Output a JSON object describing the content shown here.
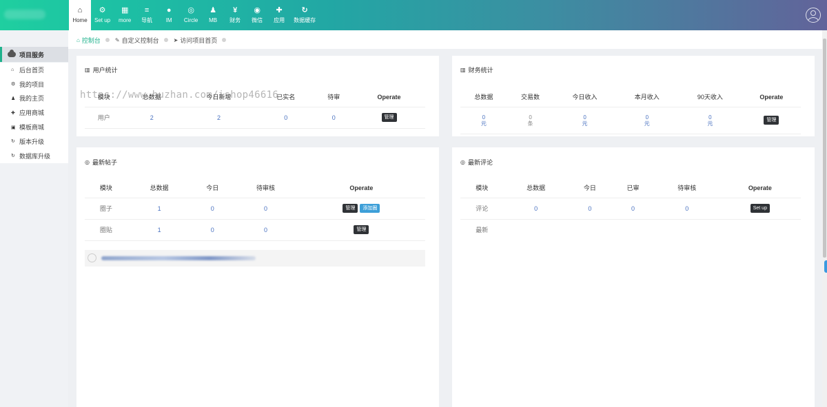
{
  "nav": [
    {
      "icon": "⌂",
      "label": "Home",
      "active": true
    },
    {
      "icon": "⚙",
      "label": "Set up"
    },
    {
      "icon": "▦",
      "label": "more"
    },
    {
      "icon": "≡",
      "label": "导航"
    },
    {
      "icon": "●",
      "label": "IM"
    },
    {
      "icon": "◎",
      "label": "Circle"
    },
    {
      "icon": "♟",
      "label": "MB"
    },
    {
      "icon": "¥",
      "label": "财务"
    },
    {
      "icon": "◉",
      "label": "微信"
    },
    {
      "icon": "✚",
      "label": "应用"
    },
    {
      "icon": "↻",
      "label": "数据缓存"
    }
  ],
  "sidebar": {
    "heading": "项目服务",
    "items": [
      {
        "icon": "⌂",
        "label": "后台首页"
      },
      {
        "icon": "⚙",
        "label": "我的项目"
      },
      {
        "icon": "♟",
        "label": "我的主页"
      },
      {
        "icon": "✚",
        "label": "应用商城"
      },
      {
        "icon": "▣",
        "label": "模板商城"
      },
      {
        "icon": "↻",
        "label": "版本升级"
      },
      {
        "icon": "↻",
        "label": "数据库升级"
      }
    ]
  },
  "breadcrumb": [
    {
      "icon": "⌂",
      "label": "控制台",
      "active": true
    },
    {
      "icon": "✎",
      "label": "自定义控制台"
    },
    {
      "icon": "➤",
      "label": "访问项目首页"
    }
  ],
  "watermark": "https://www.huzhan.com/ishop46616",
  "user_stats": {
    "title": "用户统计",
    "headers": [
      "模块",
      "总数据",
      "今日新增",
      "已实名",
      "待审",
      "Operate"
    ],
    "row": {
      "label": "用户",
      "total": "2",
      "today": "2",
      "verified": "0",
      "pending": "0",
      "button": "管理"
    }
  },
  "finance_stats": {
    "title": "财务统计",
    "headers": [
      "总数据",
      "交易数",
      "今日收入",
      "本月收入",
      "90天收入",
      "Operate"
    ],
    "row": {
      "total": "0",
      "total_unit": "元",
      "trades": "0",
      "trades_unit": "条",
      "today": "0",
      "today_unit": "元",
      "month": "0",
      "month_unit": "元",
      "days90": "0",
      "days90_unit": "元",
      "button": "管理"
    }
  },
  "latest_posts": {
    "title": "最新帖子",
    "headers": [
      "模块",
      "总数据",
      "今日",
      "待审核",
      "Operate"
    ],
    "rows": [
      {
        "label": "圈子",
        "total": "1",
        "today": "0",
        "pending": "0",
        "button": "管理",
        "button2": "添加圈"
      },
      {
        "label": "圈贴",
        "total": "1",
        "today": "0",
        "pending": "0",
        "button": "管理"
      }
    ]
  },
  "latest_comments": {
    "title": "最新评论",
    "headers": [
      "模块",
      "总数据",
      "今日",
      "已审",
      "待审核",
      "Operate"
    ],
    "rows": [
      {
        "label": "评论",
        "total": "0",
        "today": "0",
        "approved": "0",
        "pending": "0",
        "button": "Set up"
      },
      {
        "label": "最新"
      }
    ]
  }
}
